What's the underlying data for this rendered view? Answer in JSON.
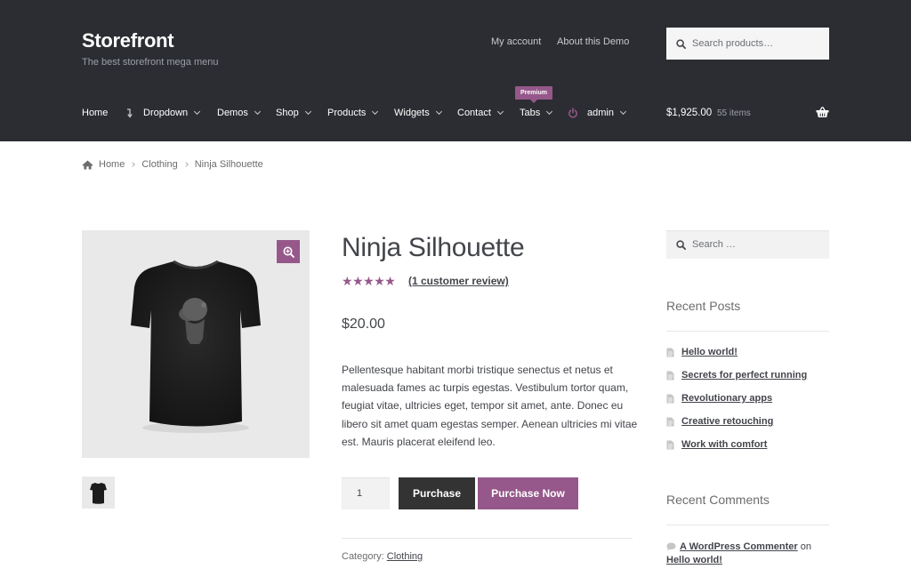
{
  "header": {
    "site_title": "Storefront",
    "site_description": "The best storefront mega menu",
    "top_links": [
      "My account",
      "About this Demo"
    ],
    "search_placeholder": "Search products…",
    "nav": {
      "home": "Home",
      "dropdown": "Dropdown",
      "demos": "Demos",
      "shop": "Shop",
      "products": "Products",
      "widgets": "Widgets",
      "contact": "Contact",
      "tabs": "Tabs",
      "admin": "admin",
      "premium_badge": "Premium"
    },
    "cart": {
      "amount": "$1,925.00",
      "count": "55 items"
    }
  },
  "breadcrumb": {
    "home": "Home",
    "category": "Clothing",
    "current": "Ninja Silhouette"
  },
  "product": {
    "title": "Ninja Silhouette",
    "rating": "5 out of 5",
    "review_link": "(1 customer review)",
    "price": "$20.00",
    "description": "Pellentesque habitant morbi tristique senectus et netus et malesuada fames ac turpis egestas. Vestibulum tortor quam, feugiat vitae, ultricies eget, tempor sit amet, ante. Donec eu libero sit amet quam egestas semper. Aenean ultricies mi vitae est. Mauris placerat eleifend leo.",
    "quantity": "1",
    "purchase_label": "Purchase",
    "purchase_now_label": "Purchase Now",
    "category_label": "Category:",
    "category_value": "Clothing"
  },
  "sidebar": {
    "search_placeholder": "Search …",
    "recent_posts_title": "Recent Posts",
    "recent_posts": [
      "Hello world!",
      "Secrets for perfect running",
      "Revolutionary apps",
      "Creative retouching",
      "Work with comfort"
    ],
    "recent_comments_title": "Recent Comments",
    "comment": {
      "author": "A WordPress Commenter",
      "on": "on",
      "post": "Hello world!"
    }
  },
  "colors": {
    "accent": "#96588a",
    "header_bg": "#2c2d33",
    "dark_button": "#333333"
  },
  "icons": [
    "search-icon",
    "dropdown-arrow-icon",
    "power-icon",
    "basket-icon",
    "home-icon",
    "zoom-icon",
    "document-icon",
    "comment-icon"
  ]
}
